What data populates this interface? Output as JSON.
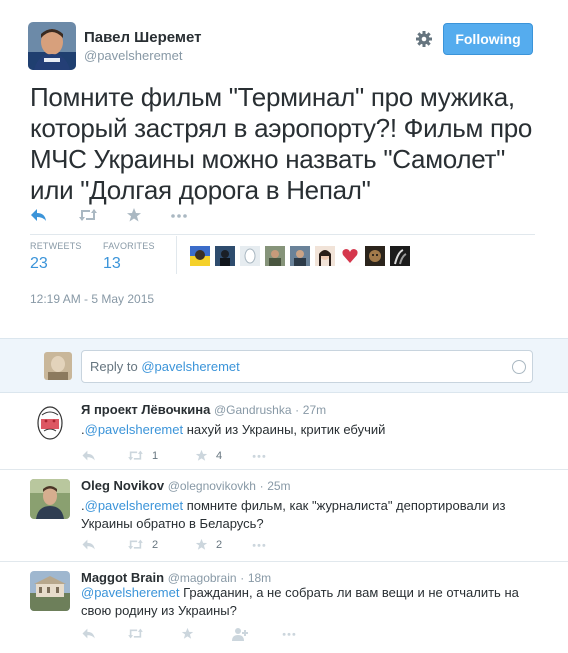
{
  "tweet": {
    "author_name": "Павел Шеремет",
    "author_handle": "@pavelsheremet",
    "follow_label": "Following",
    "text": "Помните фильм \"Терминал\" про мужика, который застрял в аэропорту?! Фильм про МЧС Украины можно назвать \"Самолет\" или \"Долгая дорога в Непал\"",
    "retweets_label": "RETWEETS",
    "retweets_count": "23",
    "favorites_label": "FAVORITES",
    "favorites_count": "13",
    "timestamp": "12:19 AM - 5 May 2015",
    "accent_color": "#55acee"
  },
  "reply_box": {
    "placeholder_prefix": "Reply to ",
    "placeholder_handle": "@pavelsheremet"
  },
  "replies": [
    {
      "name": "Я проект Лёвочкина",
      "handle": "@Gandrushka",
      "time": "27m",
      "line_prefix": ".",
      "mention": "@pavelsheremet",
      "text": " нахуй из Украины, критик ебучий",
      "retweets": "1",
      "favorites": "4"
    },
    {
      "name": "Oleg Novikov",
      "handle": "@olegnovikovkh",
      "time": "25m",
      "line_prefix": ".",
      "mention": "@pavelsheremet",
      "text": " помните фильм, как \"журналиста\" депортировали из Украины обратно в Беларусь?",
      "retweets": "2",
      "favorites": "2"
    },
    {
      "name": "Maggot Brain",
      "handle": "@magobrain",
      "time": "18m",
      "line_prefix": "",
      "mention": "@pavelsheremet",
      "text": " Гражданин, а не собрать ли вам вещи и не отчалить на свою родину из Украины?",
      "retweets": "",
      "favorites": ""
    }
  ],
  "icons": [
    "gear-icon",
    "reply-icon",
    "retweet-icon",
    "favorite-icon",
    "more-icon",
    "emoji-icon",
    "follow-user-icon"
  ]
}
